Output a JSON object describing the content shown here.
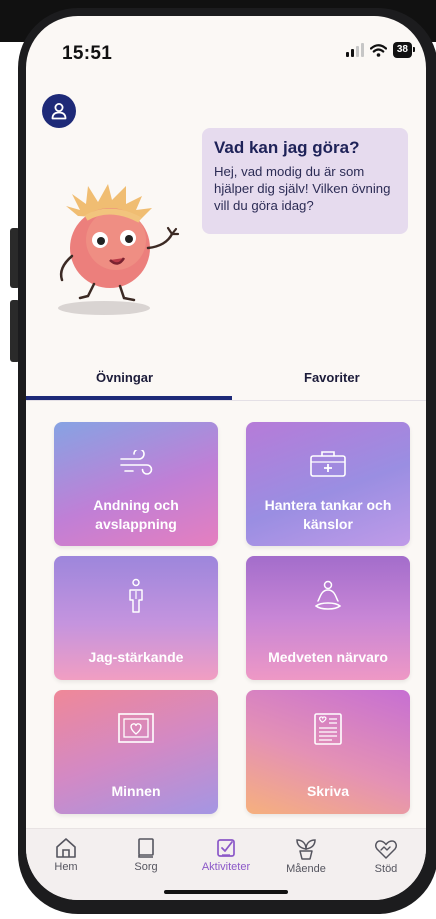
{
  "status_bar": {
    "time": "15:51",
    "battery": "38"
  },
  "header": {
    "avatar_icon": "user-icon"
  },
  "greeting": {
    "title": "Vad kan jag göra?",
    "text": "Hej, vad modig du är som hjälper dig själv! Vilken övning vill du göra idag?"
  },
  "tabs": [
    {
      "label": "Övningar",
      "active": true
    },
    {
      "label": "Favoriter",
      "active": false
    }
  ],
  "exercises": [
    {
      "label": "Andning och avslappning",
      "icon": "wind-icon"
    },
    {
      "label": "Hantera tankar och känslor",
      "icon": "first-aid-kit-icon"
    },
    {
      "label": "Jag-stärkande",
      "icon": "person-icon"
    },
    {
      "label": "Medveten närvaro",
      "icon": "meditation-icon"
    },
    {
      "label": "Minnen",
      "icon": "heart-frame-icon"
    },
    {
      "label": "Skriva",
      "icon": "notebook-icon"
    }
  ],
  "bottom_nav": [
    {
      "label": "Hem",
      "icon": "home-icon"
    },
    {
      "label": "Sorg",
      "icon": "book-icon"
    },
    {
      "label": "Aktiviteter",
      "icon": "checkbox-icon",
      "active": true
    },
    {
      "label": "Mående",
      "icon": "plant-icon"
    },
    {
      "label": "Stöd",
      "icon": "heart-hands-icon"
    }
  ],
  "colors": {
    "accent": "#1e2a78",
    "active_nav": "#8b58c8",
    "bubble": "#e6dbee"
  }
}
